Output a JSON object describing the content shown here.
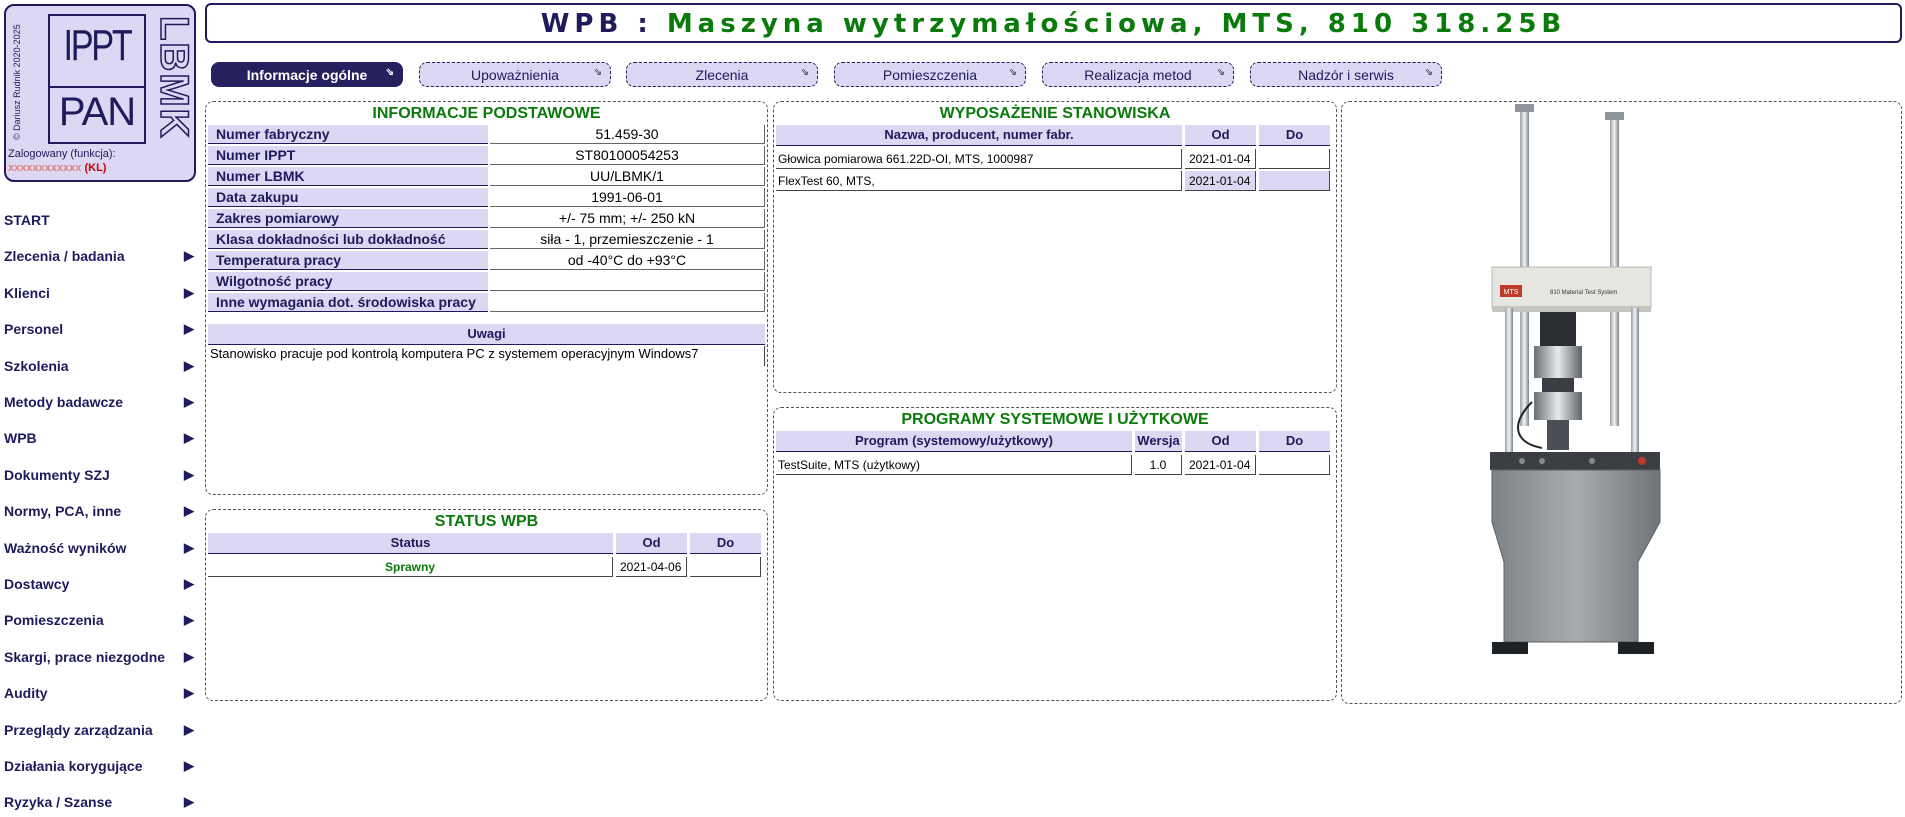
{
  "logo": {
    "copyright": "© Dariusz Rudnik 2020-2025",
    "ippt": "IPPT",
    "pan": "PAN",
    "lbmk": "LBMK",
    "login_label": "Zalogowany (funkcja):",
    "login_user": "xxxxxxxxxxxx",
    "login_role": "(KL)"
  },
  "sidebar": {
    "items": [
      {
        "label": "START",
        "arrow": ""
      },
      {
        "label": "Zlecenia / badania",
        "arrow": "▶"
      },
      {
        "label": "Klienci",
        "arrow": "▶"
      },
      {
        "label": "Personel",
        "arrow": "▶"
      },
      {
        "label": "Szkolenia",
        "arrow": "▶"
      },
      {
        "label": "Metody badawcze",
        "arrow": "▶"
      },
      {
        "label": "WPB",
        "arrow": "▶"
      },
      {
        "label": "Dokumenty SZJ",
        "arrow": "▶"
      },
      {
        "label": "Normy, PCA, inne",
        "arrow": "▶"
      },
      {
        "label": "Ważność wyników",
        "arrow": "▶"
      },
      {
        "label": "Dostawcy",
        "arrow": "▶"
      },
      {
        "label": "Pomieszczenia",
        "arrow": "▶"
      },
      {
        "label": "Skargi, prace niezgodne",
        "arrow": "▶"
      },
      {
        "label": "Audity",
        "arrow": "▶"
      },
      {
        "label": "Przeglądy zarządzania",
        "arrow": "▶"
      },
      {
        "label": "Działania korygujące",
        "arrow": "▶"
      },
      {
        "label": "Ryzyka / Szanse",
        "arrow": "▶"
      }
    ]
  },
  "header": {
    "prefix": "WPB : ",
    "title": "Maszyna wytrzymałościowa, MTS, 810 318.25B"
  },
  "tabs": [
    {
      "label": "Informacje ogólne",
      "icon": "⇘"
    },
    {
      "label": "Upoważnienia",
      "icon": "⇘"
    },
    {
      "label": "Zlecenia",
      "icon": "⇘"
    },
    {
      "label": "Pomieszczenia",
      "icon": "⇘"
    },
    {
      "label": "Realizacja metod",
      "icon": "⇘"
    },
    {
      "label": "Nadzór i serwis",
      "icon": "⇘"
    }
  ],
  "info": {
    "title": "INFORMACJE PODSTAWOWE",
    "rows": [
      {
        "key": "Numer fabryczny",
        "value": "51.459-30"
      },
      {
        "key": "Numer IPPT",
        "value": "ST80100054253"
      },
      {
        "key": "Numer LBMK",
        "value": "UU/LBMK/1"
      },
      {
        "key": "Data zakupu",
        "value": "1991-06-01"
      },
      {
        "key": "Zakres pomiarowy",
        "value": "+/- 75 mm; +/- 250 kN"
      },
      {
        "key": "Klasa dokładności lub dokładność",
        "value": "siła - 1, przemieszczenie - 1"
      },
      {
        "key": "Temperatura pracy",
        "value": "od -40°C do +93°C"
      },
      {
        "key": "Wilgotność pracy",
        "value": ""
      },
      {
        "key": "Inne wymagania dot. środowiska pracy",
        "value": ""
      }
    ],
    "notes_header": "Uwagi",
    "notes": "Stanowisko pracuje pod kontrolą komputera PC z systemem operacyjnym Windows7"
  },
  "status": {
    "title": "STATUS WPB",
    "headers": [
      "Status",
      "Od",
      "Do"
    ],
    "rows": [
      {
        "status": "Sprawny",
        "od": "2021-04-06",
        "do": ""
      }
    ]
  },
  "equipment": {
    "title": "WYPOSAŻENIE STANOWISKA",
    "headers": [
      "Nazwa, producent, numer fabr.",
      "Od",
      "Do"
    ],
    "rows": [
      {
        "name": "Głowica pomiarowa 661.22D-OI, MTS, 1000987",
        "od": "2021-01-04",
        "do": ""
      },
      {
        "name": "FlexTest 60, MTS,",
        "od": "2021-01-04",
        "do": ""
      }
    ]
  },
  "programs": {
    "title": "PROGRAMY SYSTEMOWE I UŻYTKOWE",
    "headers": [
      "Program (systemowy/użytkowy)",
      "Wersja",
      "Od",
      "Do"
    ],
    "rows": [
      {
        "name": "TestSuite, MTS (użytkowy)",
        "version": "1.0",
        "od": "2021-01-04",
        "do": ""
      }
    ]
  },
  "photo": {
    "brand": "MTS",
    "caption": "810 Material Test System"
  },
  "colors": {
    "brand_dark": "#1f1a5c",
    "header_bg": "#dcd7f3",
    "title_green": "#0a7a0a",
    "tab_active": "#27205f"
  }
}
